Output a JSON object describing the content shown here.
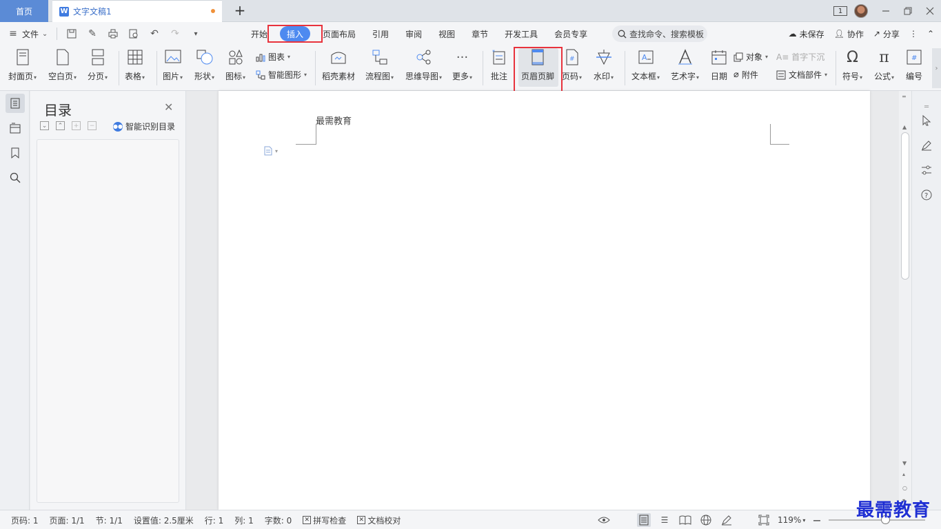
{
  "tabbar": {
    "home_label": "首页",
    "doc_icon": "W",
    "doc_title": "文字文稿1",
    "new_tab": "+",
    "page_badge": "1"
  },
  "menu": {
    "file_label": "文件",
    "ribbon_tabs": [
      "开始",
      "插入",
      "页面布局",
      "引用",
      "审阅",
      "视图",
      "章节",
      "开发工具",
      "会员专享"
    ],
    "active_tab": "插入",
    "search_placeholder": "查找命令、搜索模板",
    "unsaved_label": "未保存",
    "collab_label": "协作",
    "share_label": "分享"
  },
  "ribbon": {
    "cover": "封面页",
    "blank": "空白页",
    "break": "分页",
    "table": "表格",
    "picture": "图片",
    "shape": "形状",
    "icon": "图标",
    "chart": "图表",
    "smartart": "智能图形",
    "daoke": "稻壳素材",
    "flow": "流程图",
    "mindmap": "思维导图",
    "more": "更多",
    "comment": "批注",
    "header_footer": "页眉页脚",
    "page_number": "页码",
    "watermark": "水印",
    "textbox": "文本框",
    "wordart": "艺术字",
    "date": "日期",
    "object": "对象",
    "attachment": "附件",
    "dropcap": "首字下沉",
    "docpart": "文档部件",
    "symbol": "符号",
    "formula": "公式",
    "numbering": "编号"
  },
  "toc": {
    "title": "目录",
    "smart_label": "智能识别目录"
  },
  "document": {
    "header_text": "最需教育"
  },
  "status": {
    "page_code": "页码: 1",
    "page": "页面: 1/1",
    "section": "节: 1/1",
    "setting": "设置值: 2.5厘米",
    "row": "行: 1",
    "col": "列: 1",
    "word_count": "字数: 0",
    "spell_check": "拼写检查",
    "proofread": "文档校对",
    "zoom": "119%",
    "zoom_level": 0.6
  },
  "watermark_text": "最需教育",
  "colors": {
    "accent": "#4e8af0",
    "highlight_box": "#e8323c",
    "home_tab": "#5b8bd6",
    "watermark": "#1f2fd3"
  }
}
